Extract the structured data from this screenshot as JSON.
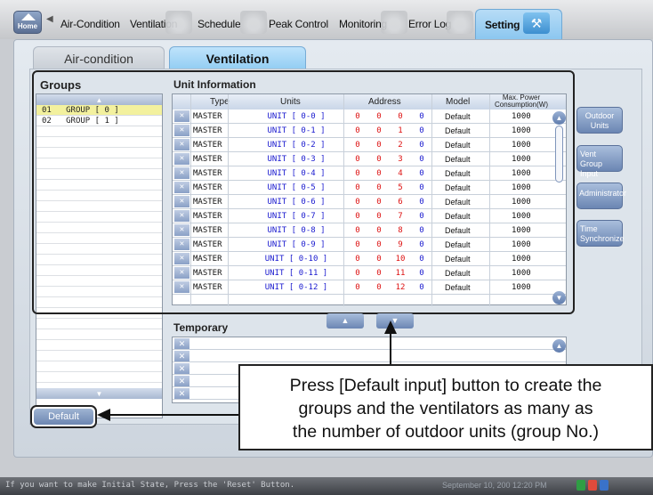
{
  "topbar": {
    "home_label": "Home",
    "tabs": [
      "Air-Condition",
      "Ventilation",
      "Schedule",
      "Peak Control",
      "Monitoring",
      "Error Log",
      "Setting"
    ],
    "active_tab": "Setting"
  },
  "subtabs": {
    "left": "Air-condition",
    "right": "Ventilation"
  },
  "groups": {
    "title": "Groups",
    "items": [
      {
        "no": "01",
        "name": "GROUP [ 0 ]"
      },
      {
        "no": "02",
        "name": "GROUP [ 1 ]"
      }
    ],
    "default_label": "Default"
  },
  "unit_info": {
    "title": "Unit Information",
    "headers": {
      "type": "Type",
      "units": "Units",
      "address": "Address",
      "model": "Model",
      "power": "Max. Power Consumption(W)"
    },
    "rows": [
      {
        "type": "MASTER",
        "unit": "UNIT [ 0-0 ]",
        "addr": [
          "0",
          "0",
          "0",
          "0"
        ],
        "model": "Default",
        "power": "1000"
      },
      {
        "type": "MASTER",
        "unit": "UNIT [ 0-1 ]",
        "addr": [
          "0",
          "0",
          "1",
          "0"
        ],
        "model": "Default",
        "power": "1000"
      },
      {
        "type": "MASTER",
        "unit": "UNIT [ 0-2 ]",
        "addr": [
          "0",
          "0",
          "2",
          "0"
        ],
        "model": "Default",
        "power": "1000"
      },
      {
        "type": "MASTER",
        "unit": "UNIT [ 0-3 ]",
        "addr": [
          "0",
          "0",
          "3",
          "0"
        ],
        "model": "Default",
        "power": "1000"
      },
      {
        "type": "MASTER",
        "unit": "UNIT [ 0-4 ]",
        "addr": [
          "0",
          "0",
          "4",
          "0"
        ],
        "model": "Default",
        "power": "1000"
      },
      {
        "type": "MASTER",
        "unit": "UNIT [ 0-5 ]",
        "addr": [
          "0",
          "0",
          "5",
          "0"
        ],
        "model": "Default",
        "power": "1000"
      },
      {
        "type": "MASTER",
        "unit": "UNIT [ 0-6 ]",
        "addr": [
          "0",
          "0",
          "6",
          "0"
        ],
        "model": "Default",
        "power": "1000"
      },
      {
        "type": "MASTER",
        "unit": "UNIT [ 0-7 ]",
        "addr": [
          "0",
          "0",
          "7",
          "0"
        ],
        "model": "Default",
        "power": "1000"
      },
      {
        "type": "MASTER",
        "unit": "UNIT [ 0-8 ]",
        "addr": [
          "0",
          "0",
          "8",
          "0"
        ],
        "model": "Default",
        "power": "1000"
      },
      {
        "type": "MASTER",
        "unit": "UNIT [ 0-9 ]",
        "addr": [
          "0",
          "0",
          "9",
          "0"
        ],
        "model": "Default",
        "power": "1000"
      },
      {
        "type": "MASTER",
        "unit": "UNIT [ 0-10 ]",
        "addr": [
          "0",
          "0",
          "10",
          "0"
        ],
        "model": "Default",
        "power": "1000"
      },
      {
        "type": "MASTER",
        "unit": "UNIT [ 0-11 ]",
        "addr": [
          "0",
          "0",
          "11",
          "0"
        ],
        "model": "Default",
        "power": "1000"
      },
      {
        "type": "MASTER",
        "unit": "UNIT [ 0-12 ]",
        "addr": [
          "0",
          "0",
          "12",
          "0"
        ],
        "model": "Default",
        "power": "1000"
      }
    ]
  },
  "side_buttons": [
    "Outdoor Units",
    "Vent Group Input",
    "Administrator",
    "Time Synchronize"
  ],
  "temporary": {
    "title": "Temporary"
  },
  "callout": {
    "line1": "Press [Default input] button to create the",
    "line2": "groups and the ventilators as many as",
    "line3": "the  number of outdoor units (group No.)"
  },
  "status": {
    "message": "If you want to make Initial State, Press the 'Reset' Button.",
    "datetime": "September 10, 200  12:20 PM"
  },
  "colors": {
    "accent": "#8cc7f0",
    "selected_row": "#f3f19e",
    "address_red": "#dd1111",
    "unit_blue": "#1a1acf"
  }
}
